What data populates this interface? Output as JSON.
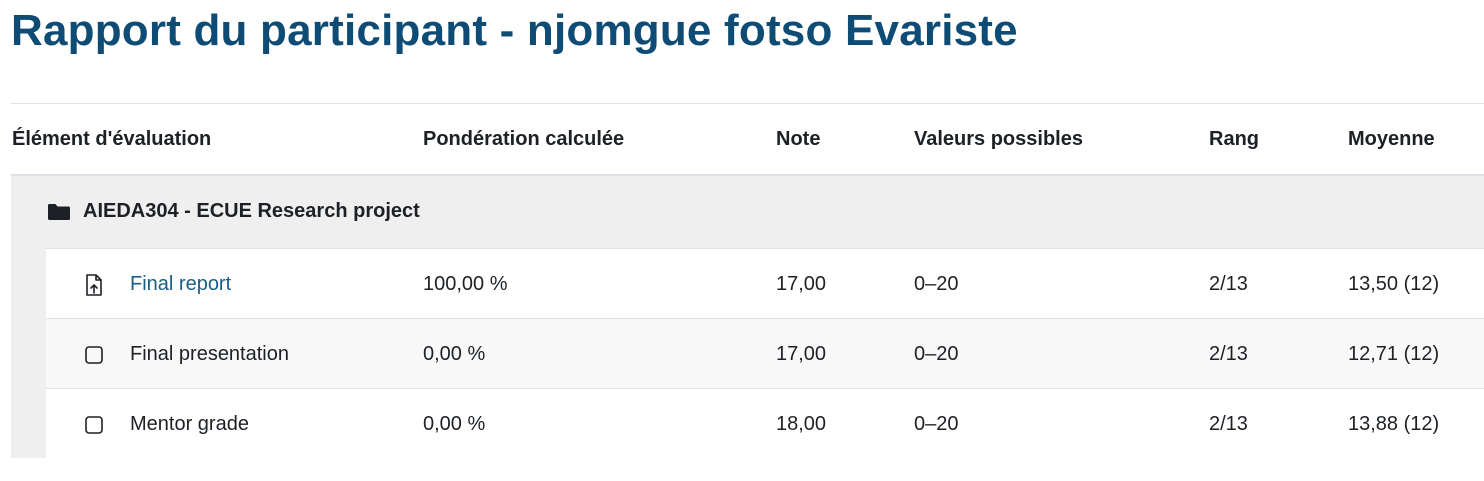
{
  "page": {
    "title": "Rapport du participant - njomgue fotso Evariste"
  },
  "table": {
    "headers": {
      "item": "Élément d'évaluation",
      "weight": "Pondération calculée",
      "grade": "Note",
      "range": "Valeurs possibles",
      "rank": "Rang",
      "average": "Moyenne"
    },
    "category": {
      "label": "AIEDA304 - ECUE Research project",
      "icon": "folder-icon"
    },
    "rows": [
      {
        "name": "Final report",
        "icon": "assignment-upload-icon",
        "is_link": true,
        "weight": "100,00 %",
        "grade": "17,00",
        "range": "0–20",
        "rank": "2/13",
        "average": "13,50 (12)"
      },
      {
        "name": "Final presentation",
        "icon": "manual-item-icon",
        "is_link": false,
        "weight": "0,00 %",
        "grade": "17,00",
        "range": "0–20",
        "rank": "2/13",
        "average": "12,71 (12)"
      },
      {
        "name": "Mentor grade",
        "icon": "manual-item-icon",
        "is_link": false,
        "weight": "0,00 %",
        "grade": "18,00",
        "range": "0–20",
        "rank": "2/13",
        "average": "13,88 (12)"
      }
    ]
  },
  "colors": {
    "title": "#0f4c75",
    "link": "#1a5e88",
    "category_band": "#efefef"
  }
}
